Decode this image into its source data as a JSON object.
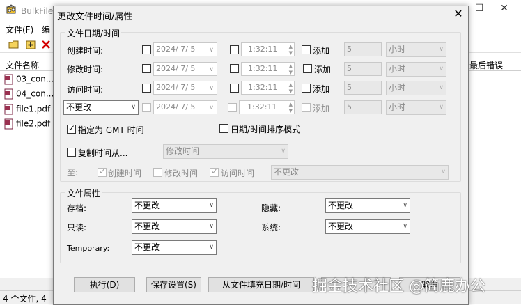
{
  "app": {
    "title": "BulkFile",
    "menu": [
      "文件(F)",
      "编"
    ],
    "columns": {
      "name": "文件名称",
      "last_error": "最后错误"
    },
    "files": [
      "03_con...",
      "04_con...",
      "file1.pdf",
      "file2.pdf"
    ],
    "status": "4 个文件, 4"
  },
  "dialog": {
    "title": "更改文件时间/属性",
    "close_glyph": "✕",
    "datetime_group": {
      "label": "文件日期/时间",
      "rows": [
        {
          "label": "创建时间:",
          "date": "2024/  7/  5",
          "time": "1:32:11",
          "add_label": "添加",
          "add_value": "5",
          "unit": "小时"
        },
        {
          "label": "修改时间:",
          "date": "2024/  7/  5",
          "time": "1:32:11",
          "add_label": "添加",
          "add_value": "5",
          "unit": "小时"
        },
        {
          "label": "访问时间:",
          "date": "2024/  7/  5",
          "time": "1:32:11",
          "add_label": "添加",
          "add_value": "5",
          "unit": "小时"
        },
        {
          "label": "不更改",
          "date": "2024/  7/  5",
          "time": "1:32:11",
          "add_label": "添加",
          "add_value": "5",
          "unit": "小时"
        }
      ],
      "gmt_label": "指定为 GMT 时间",
      "sort_label": "日期/时间排序模式",
      "copy_from_label": "复制时间从...",
      "copy_from_value": "修改时间",
      "to_label": "至:",
      "to_created": "创建时间",
      "to_modified": "修改时间",
      "to_accessed": "访问时间",
      "to_combo_value": "不更改"
    },
    "attr_group": {
      "label": "文件属性",
      "archive_label": "存档:",
      "archive_value": "不更改",
      "hidden_label": "隐藏:",
      "hidden_value": "不更改",
      "readonly_label": "只读:",
      "readonly_value": "不更改",
      "system_label": "系统:",
      "system_value": "不更改",
      "temporary_label": "Temporary:",
      "temporary_value": "不更改"
    },
    "buttons": {
      "execute": "执行(D)",
      "save": "保存设置(S)",
      "fill": "从文件填充日期/时间",
      "cancel": "取消"
    }
  },
  "watermark": "掘金技术社区 @简鹿办公",
  "colors": {
    "dialog_bg": "#f0f0f0",
    "disabled_text": "#8a8a8a"
  }
}
